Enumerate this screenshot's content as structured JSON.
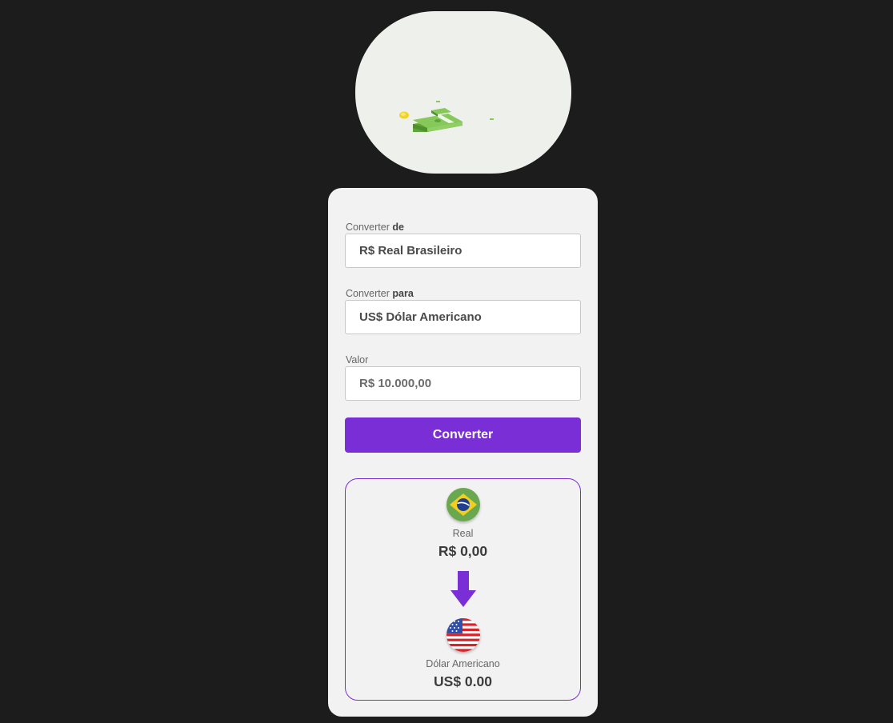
{
  "logo": {
    "icon": "money-stack-icon"
  },
  "form": {
    "from": {
      "label_prefix": "Converter",
      "label_bold": "de",
      "value": "R$ Real Brasileiro"
    },
    "to": {
      "label_prefix": "Converter",
      "label_bold": "para",
      "value": "US$ Dólar Americano"
    },
    "amount": {
      "label": "Valor",
      "placeholder": "R$ 10.000,00"
    },
    "button_label": "Converter"
  },
  "result": {
    "source": {
      "flag": "brazil-flag-icon",
      "name": "Real",
      "value": "R$ 0,00"
    },
    "arrow": "arrow-down-icon",
    "target": {
      "flag": "usa-flag-icon",
      "name": "Dólar Americano",
      "value": "US$ 0.00"
    }
  },
  "colors": {
    "background": "#1c1c1c",
    "card": "#f2f2f2",
    "accent": "#7a2ed5"
  }
}
